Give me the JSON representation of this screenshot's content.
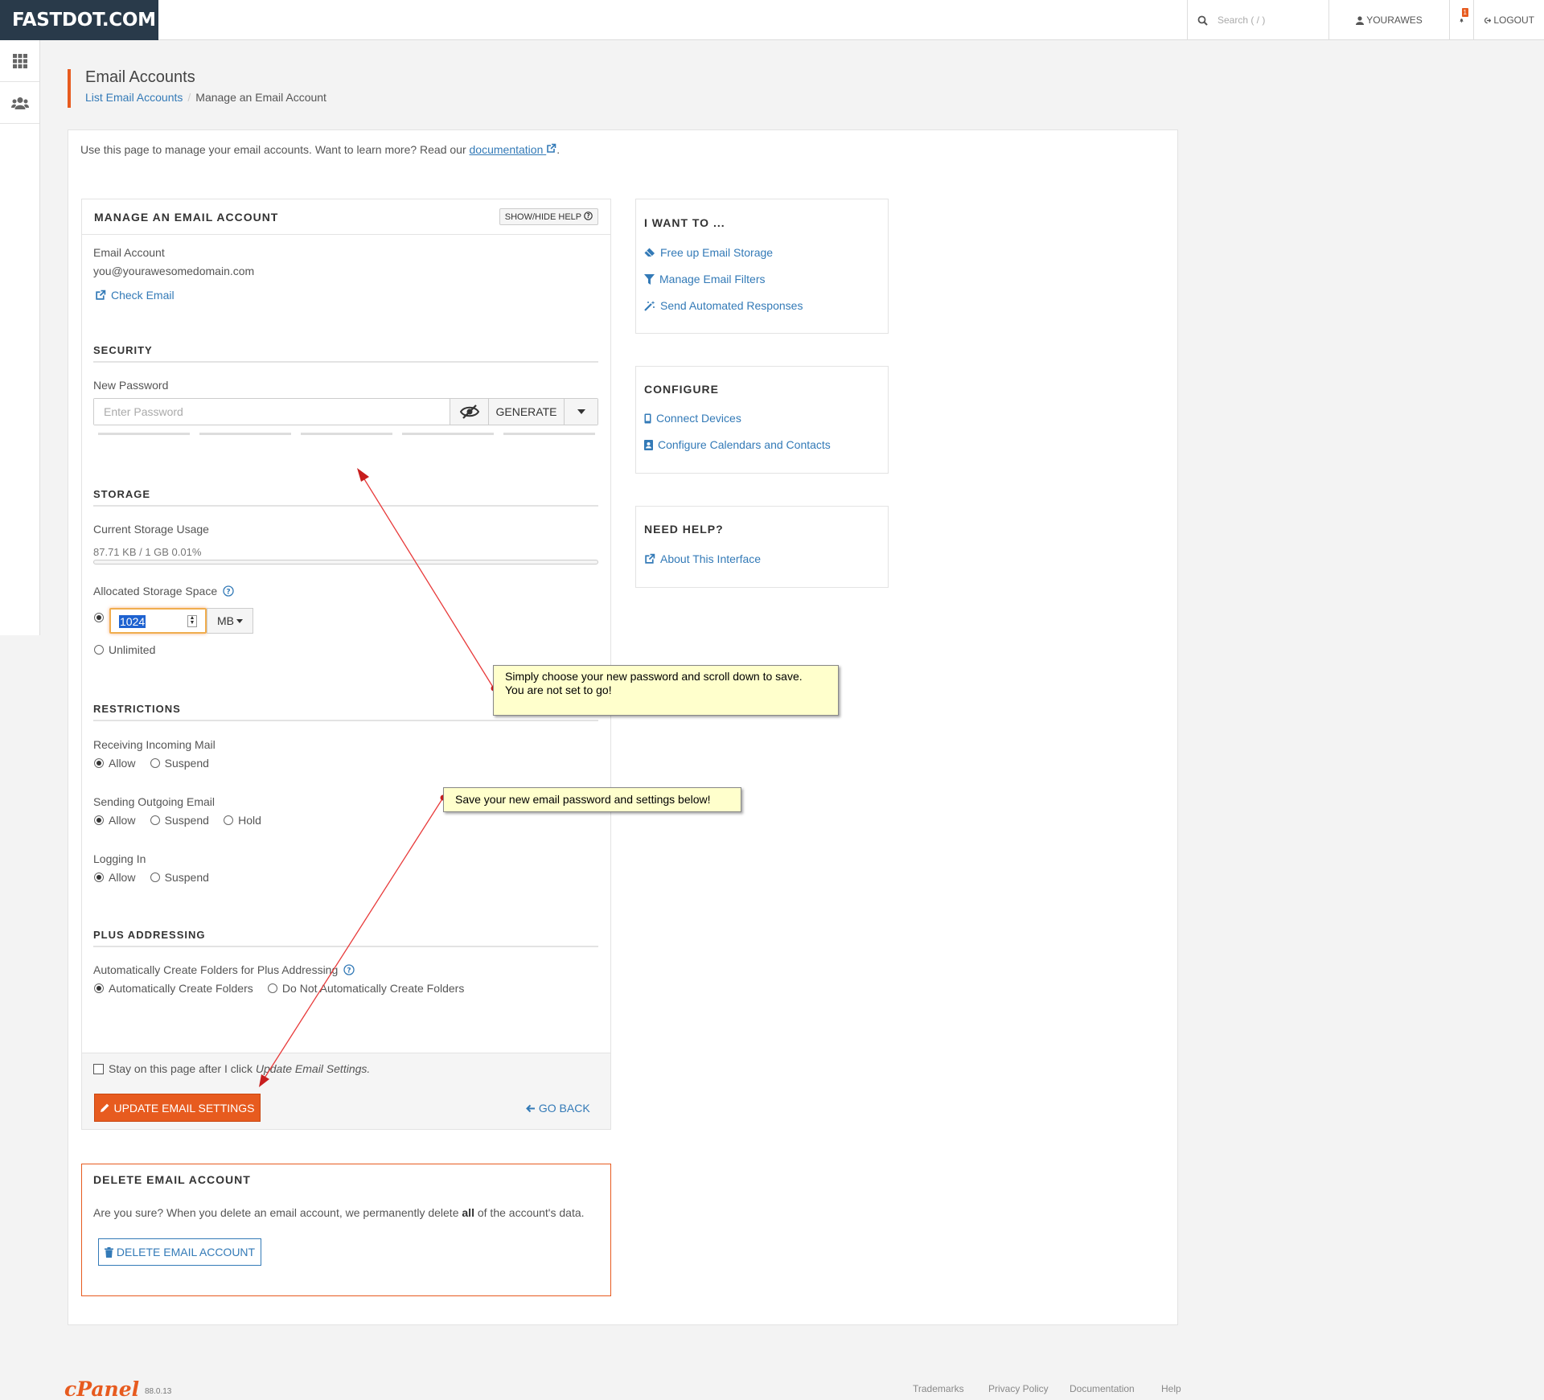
{
  "brand": "FASTDOT.COM",
  "topbar": {
    "search_placeholder": "Search ( / )",
    "user": "YOURAWES",
    "notifications_count": "1",
    "logout": "LOGOUT"
  },
  "header": {
    "title": "Email Accounts",
    "breadcrumb_link": "List Email Accounts",
    "breadcrumb_current": "Manage an Email Account"
  },
  "intro": {
    "text": "Use this page to manage your email accounts. Want to learn more? Read our",
    "link": "documentation",
    "end": "."
  },
  "manage": {
    "title": "MANAGE AN EMAIL ACCOUNT",
    "help_button": "SHOW/HIDE HELP",
    "account_label": "Email Account",
    "account": "you@yourawesomedomain.com",
    "check_email": "Check Email"
  },
  "security": {
    "title": "SECURITY",
    "password_label": "New Password",
    "password_placeholder": "Enter Password",
    "generate": "GENERATE"
  },
  "storage": {
    "title": "STORAGE",
    "usage_label": "Current Storage Usage",
    "usage_value": "87.71 KB / 1 GB 0.01%",
    "usage_fraction": 0.0001,
    "allocated_label": "Allocated Storage Space",
    "quota_value": "1024",
    "unit": "MB",
    "unlimited": "Unlimited"
  },
  "restrictions": {
    "title": "RESTRICTIONS",
    "incoming_label": "Receiving Incoming Mail",
    "incoming_options": [
      "Allow",
      "Suspend"
    ],
    "outgoing_label": "Sending Outgoing Email",
    "outgoing_options": [
      "Allow",
      "Suspend",
      "Hold"
    ],
    "login_label": "Logging In",
    "login_options": [
      "Allow",
      "Suspend"
    ]
  },
  "plus": {
    "title": "PLUS ADDRESSING",
    "label": "Automatically Create Folders for Plus Addressing",
    "option_on": "Automatically Create Folders",
    "option_off": "Do Not Automatically Create Folders"
  },
  "footer_actions": {
    "stay_text": "Stay on this page after I click",
    "stay_italic": "Update Email Settings.",
    "update": "UPDATE EMAIL SETTINGS",
    "go_back": "GO BACK"
  },
  "delete": {
    "title": "DELETE EMAIL ACCOUNT",
    "text_before": "Are you sure? When you delete an email account, we permanently delete",
    "text_bold": "all",
    "text_after": "of the account's data.",
    "button": "DELETE EMAIL ACCOUNT"
  },
  "i_want_to": {
    "title": "I WANT TO ...",
    "links": [
      "Free up Email Storage",
      "Manage Email Filters",
      "Send Automated Responses"
    ]
  },
  "configure": {
    "title": "CONFIGURE",
    "links": [
      "Connect Devices",
      "Configure Calendars and Contacts"
    ]
  },
  "need_help": {
    "title": "NEED HELP?",
    "link": "About This Interface"
  },
  "annotations": {
    "tip1_line1": "Simply choose your new password and scroll down to save.",
    "tip1_line2": "You are not set to go!",
    "tip2": "Save your new email password and settings below!"
  },
  "footer": {
    "logo": "cPanel",
    "version": "88.0.13",
    "links": [
      "Trademarks",
      "Privacy Policy",
      "Documentation",
      "Help"
    ]
  },
  "colors": {
    "accent": "#e75b1f",
    "link": "#337ab7",
    "brand_bg": "#293a4a",
    "annotation_bg": "#ffffcc",
    "arrow": "#e83a3a"
  }
}
